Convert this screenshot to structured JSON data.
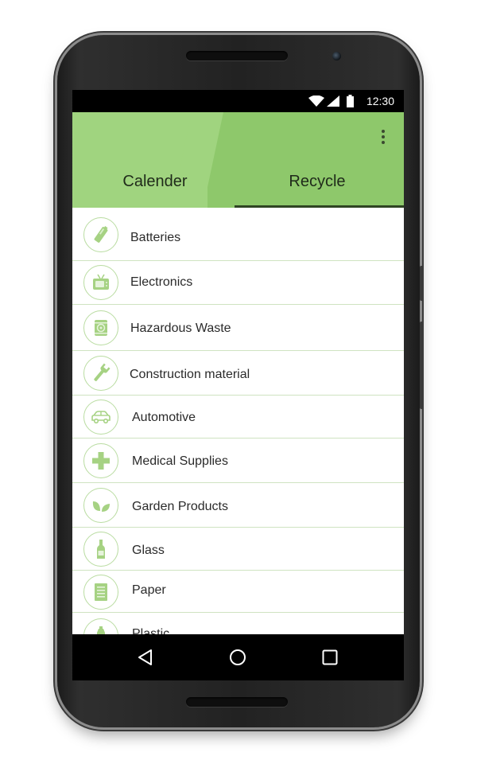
{
  "status_bar": {
    "time": "12:30"
  },
  "app": {
    "tabs": [
      {
        "label": "Calender",
        "selected": false
      },
      {
        "label": "Recycle",
        "selected": true
      }
    ],
    "colors": {
      "accent": "#8ec86b",
      "accent_light": "#a0d47f",
      "indicator": "#2f4423",
      "divider": "#cfe3c1",
      "icon": "#a6d283"
    }
  },
  "list": {
    "items": [
      {
        "label": "Batteries",
        "icon": "battery-icon"
      },
      {
        "label": "Electronics",
        "icon": "tv-icon"
      },
      {
        "label": "Hazardous Waste",
        "icon": "biohazard-icon"
      },
      {
        "label": "Construction material",
        "icon": "wrench-icon"
      },
      {
        "label": "Automotive",
        "icon": "car-icon"
      },
      {
        "label": "Medical Supplies",
        "icon": "medical-cross-icon"
      },
      {
        "label": "Garden Products",
        "icon": "leaves-icon"
      },
      {
        "label": "Glass",
        "icon": "bottle-icon"
      },
      {
        "label": "Paper",
        "icon": "paper-icon"
      },
      {
        "label": "Plastic",
        "icon": "plastic-bottle-icon"
      }
    ]
  },
  "nav_bar": {
    "buttons": [
      "back-icon",
      "home-icon",
      "recents-icon"
    ]
  }
}
